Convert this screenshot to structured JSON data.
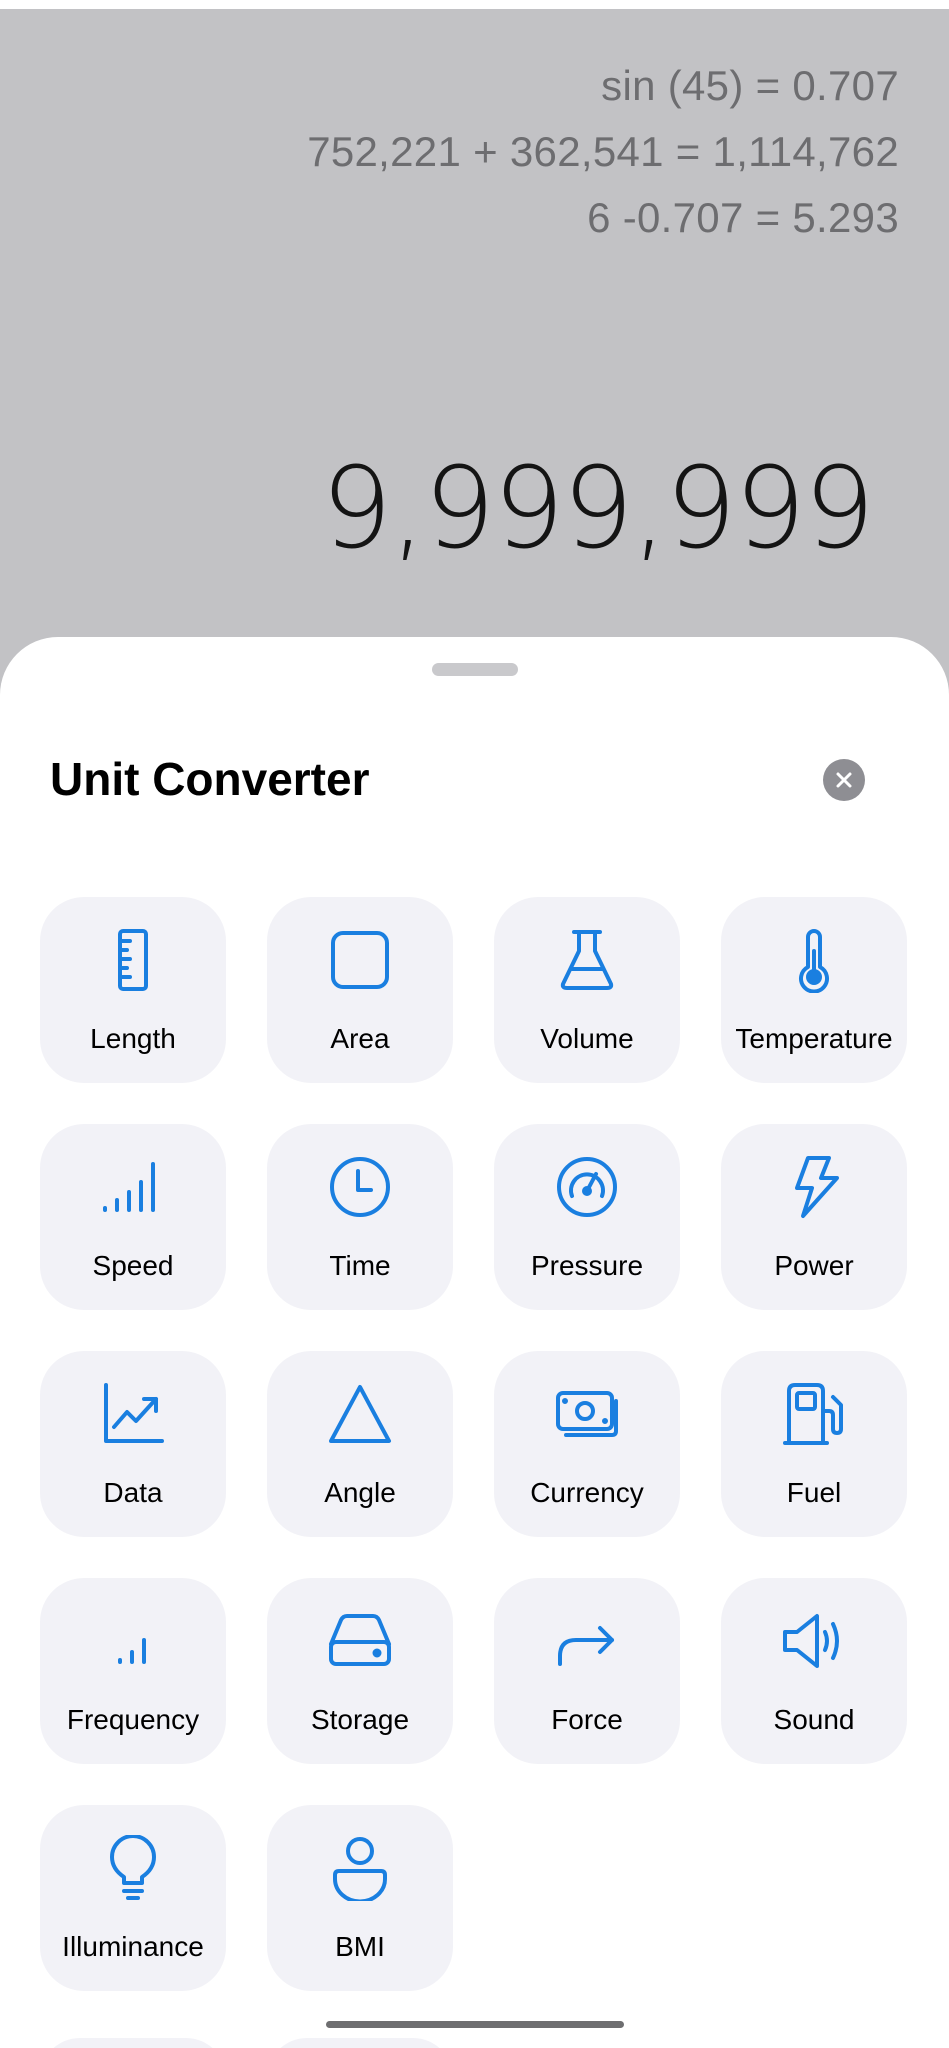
{
  "history": [
    "sin (45) = 0.707",
    "752,221 + 362,541 = 1,114,762",
    "6 -0.707 = 5.293"
  ],
  "display_value": "9,999,999",
  "sheet": {
    "title": "Unit Converter",
    "close_icon": "close-icon"
  },
  "accent_color": "#1a7fe0",
  "converters": [
    {
      "label": "Length",
      "icon": "ruler-icon"
    },
    {
      "label": "Area",
      "icon": "square-icon"
    },
    {
      "label": "Volume",
      "icon": "flask-icon"
    },
    {
      "label": "Temperature",
      "icon": "thermometer-icon"
    },
    {
      "label": "Speed",
      "icon": "signal-bars-icon"
    },
    {
      "label": "Time",
      "icon": "clock-icon"
    },
    {
      "label": "Pressure",
      "icon": "gauge-icon"
    },
    {
      "label": "Power",
      "icon": "lightning-icon"
    },
    {
      "label": "Data",
      "icon": "trend-chart-icon"
    },
    {
      "label": "Angle",
      "icon": "triangle-icon"
    },
    {
      "label": "Currency",
      "icon": "banknote-icon"
    },
    {
      "label": "Fuel",
      "icon": "fuel-pump-icon"
    },
    {
      "label": "Frequency",
      "icon": "frequency-bars-icon"
    },
    {
      "label": "Storage",
      "icon": "hard-drive-icon"
    },
    {
      "label": "Force",
      "icon": "arrow-forward-icon"
    },
    {
      "label": "Sound",
      "icon": "speaker-icon"
    },
    {
      "label": "Illuminance",
      "icon": "lightbulb-icon"
    },
    {
      "label": "BMI",
      "icon": "person-icon"
    }
  ]
}
